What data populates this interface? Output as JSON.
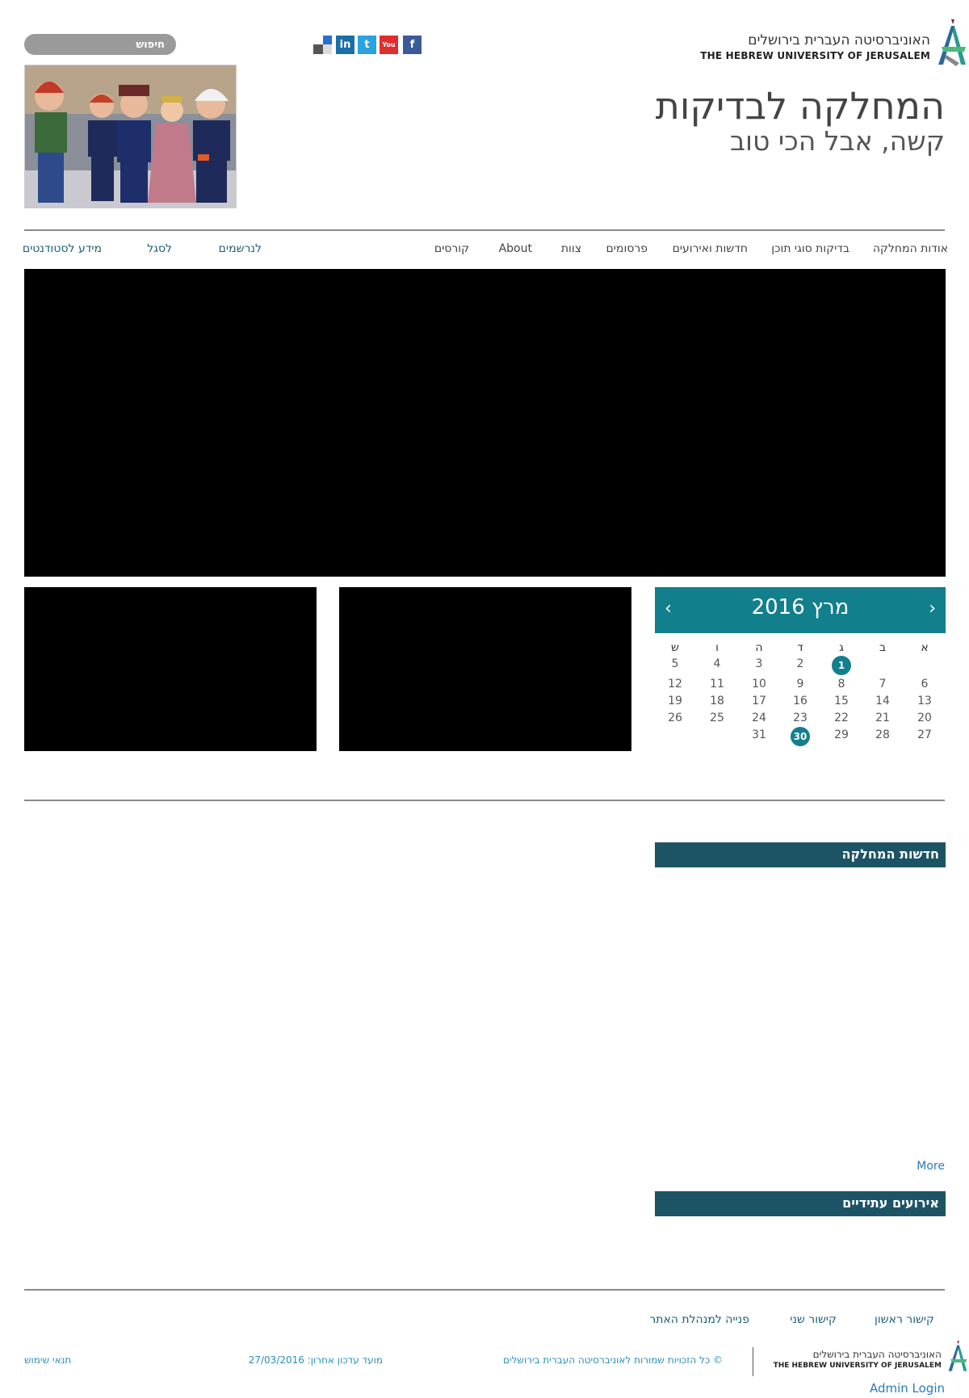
{
  "header": {
    "university_he": "האוניברסיטה העברית בירושלים",
    "university_en": "THE HEBREW UNIVERSITY OF JERUSALEM",
    "site_title": "המחלקה לבדיקות",
    "site_subtitle": "קשה, אבל הכי טוב",
    "search_placeholder": "חיפוש",
    "social": [
      {
        "icon": "delicious-icon",
        "label": ""
      },
      {
        "icon": "linkedin-icon",
        "label": "in",
        "color": "#1a6fa8"
      },
      {
        "icon": "twitter-icon",
        "label": "t",
        "color": "#2aa3e0"
      },
      {
        "icon": "youtube-icon",
        "label": "You",
        "color": "#e02d2d"
      },
      {
        "icon": "facebook-icon",
        "label": "f",
        "color": "#3b5a9a"
      }
    ]
  },
  "nav": {
    "items": [
      "אודות המחלקה",
      "בדיקות סוגי תוכן",
      "חדשות ואירועים",
      "פרסומים",
      "צוות",
      "About",
      "קורסים"
    ],
    "quick_links": [
      "לנרשמים",
      "לסגל",
      "מידע לסטודנטים"
    ]
  },
  "calendar": {
    "title": "מרץ 2016",
    "prev": "‹",
    "next": "›",
    "weekdays": [
      "א",
      "ב",
      "ג",
      "ד",
      "ה",
      "ו",
      "ש"
    ],
    "weeks": [
      [
        "",
        "",
        "1",
        "2",
        "3",
        "4",
        "5"
      ],
      [
        "6",
        "7",
        "8",
        "9",
        "10",
        "11",
        "12"
      ],
      [
        "13",
        "14",
        "15",
        "16",
        "17",
        "18",
        "19"
      ],
      [
        "20",
        "21",
        "22",
        "23",
        "24",
        "25",
        "26"
      ],
      [
        "27",
        "28",
        "29",
        "30",
        "31",
        "",
        ""
      ]
    ],
    "highlighted": [
      "1",
      "30"
    ]
  },
  "sections": {
    "news_title": "חדשות המחלקה",
    "more": "More",
    "events_title": "אירועים עתידיים"
  },
  "footer": {
    "links": [
      "קישור ראשון",
      "קישור שני",
      "פנייה למנהלת האתר"
    ],
    "university_he": "האוניברסיטה העברית בירושלים",
    "university_en": "THE HEBREW UNIVERSITY OF JERUSALEM",
    "copyright": "© כל הזכויות שמורות לאוניברסיטה העברית בירושלים",
    "last_update": "מועד עדכון אחרון: 27/03/2016",
    "terms": "תנאי שימוש",
    "admin_login": "Admin Login"
  },
  "colors": {
    "teal": "#127f8c",
    "dark_teal": "#1c5466",
    "link_blue": "#2a7bb8"
  }
}
